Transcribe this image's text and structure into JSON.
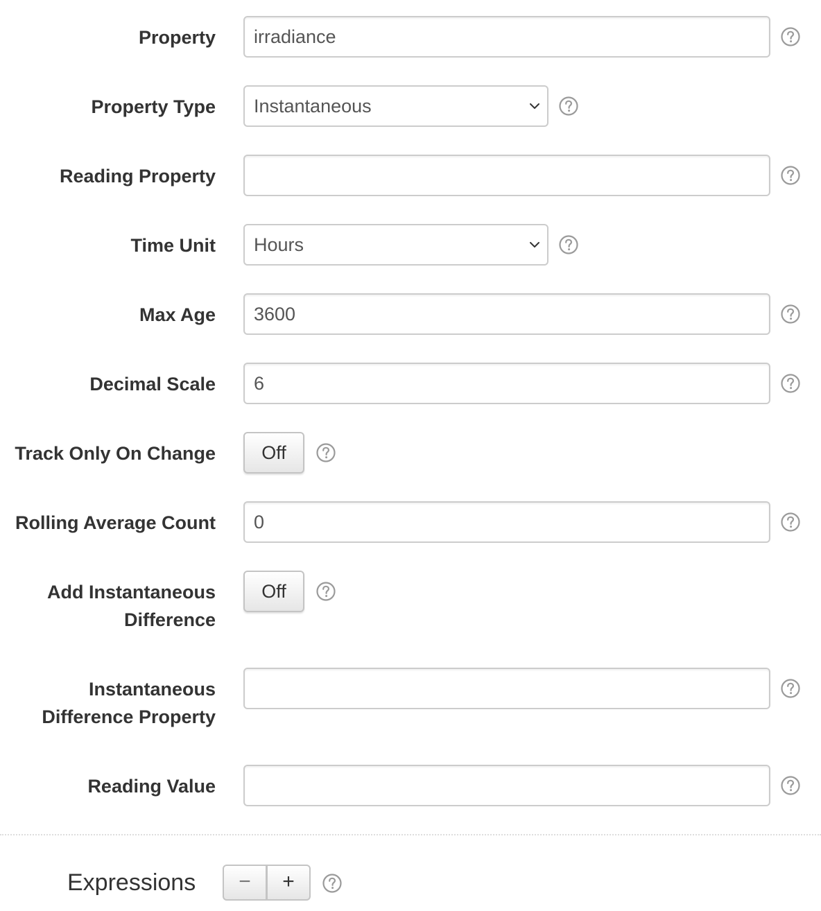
{
  "fields": {
    "property": {
      "label": "Property",
      "value": "irradiance"
    },
    "property_type": {
      "label": "Property Type",
      "value": "Instantaneous"
    },
    "reading_property": {
      "label": "Reading Property",
      "value": ""
    },
    "time_unit": {
      "label": "Time Unit",
      "value": "Hours"
    },
    "max_age": {
      "label": "Max Age",
      "value": "3600"
    },
    "decimal_scale": {
      "label": "Decimal Scale",
      "value": "6"
    },
    "track_only_on_change": {
      "label": "Track Only On Change",
      "value": "Off"
    },
    "rolling_average_count": {
      "label": "Rolling Average Count",
      "value": "0"
    },
    "add_instantaneous_difference": {
      "label_line1": "Add Instantaneous",
      "label_line2": "Difference",
      "value": "Off"
    },
    "instantaneous_difference_property": {
      "label_line1": "Instantaneous",
      "label_line2": "Difference Property",
      "value": ""
    },
    "reading_value": {
      "label": "Reading Value",
      "value": ""
    }
  },
  "expressions": {
    "title": "Expressions",
    "minus_label": "−",
    "plus_label": "+"
  },
  "icons": {
    "help": "help-circle-icon",
    "select_arrow": "chevron-down-icon"
  },
  "colors": {
    "border": "#cccccc",
    "label": "#333333",
    "value": "#555555",
    "icon": "#999999"
  }
}
